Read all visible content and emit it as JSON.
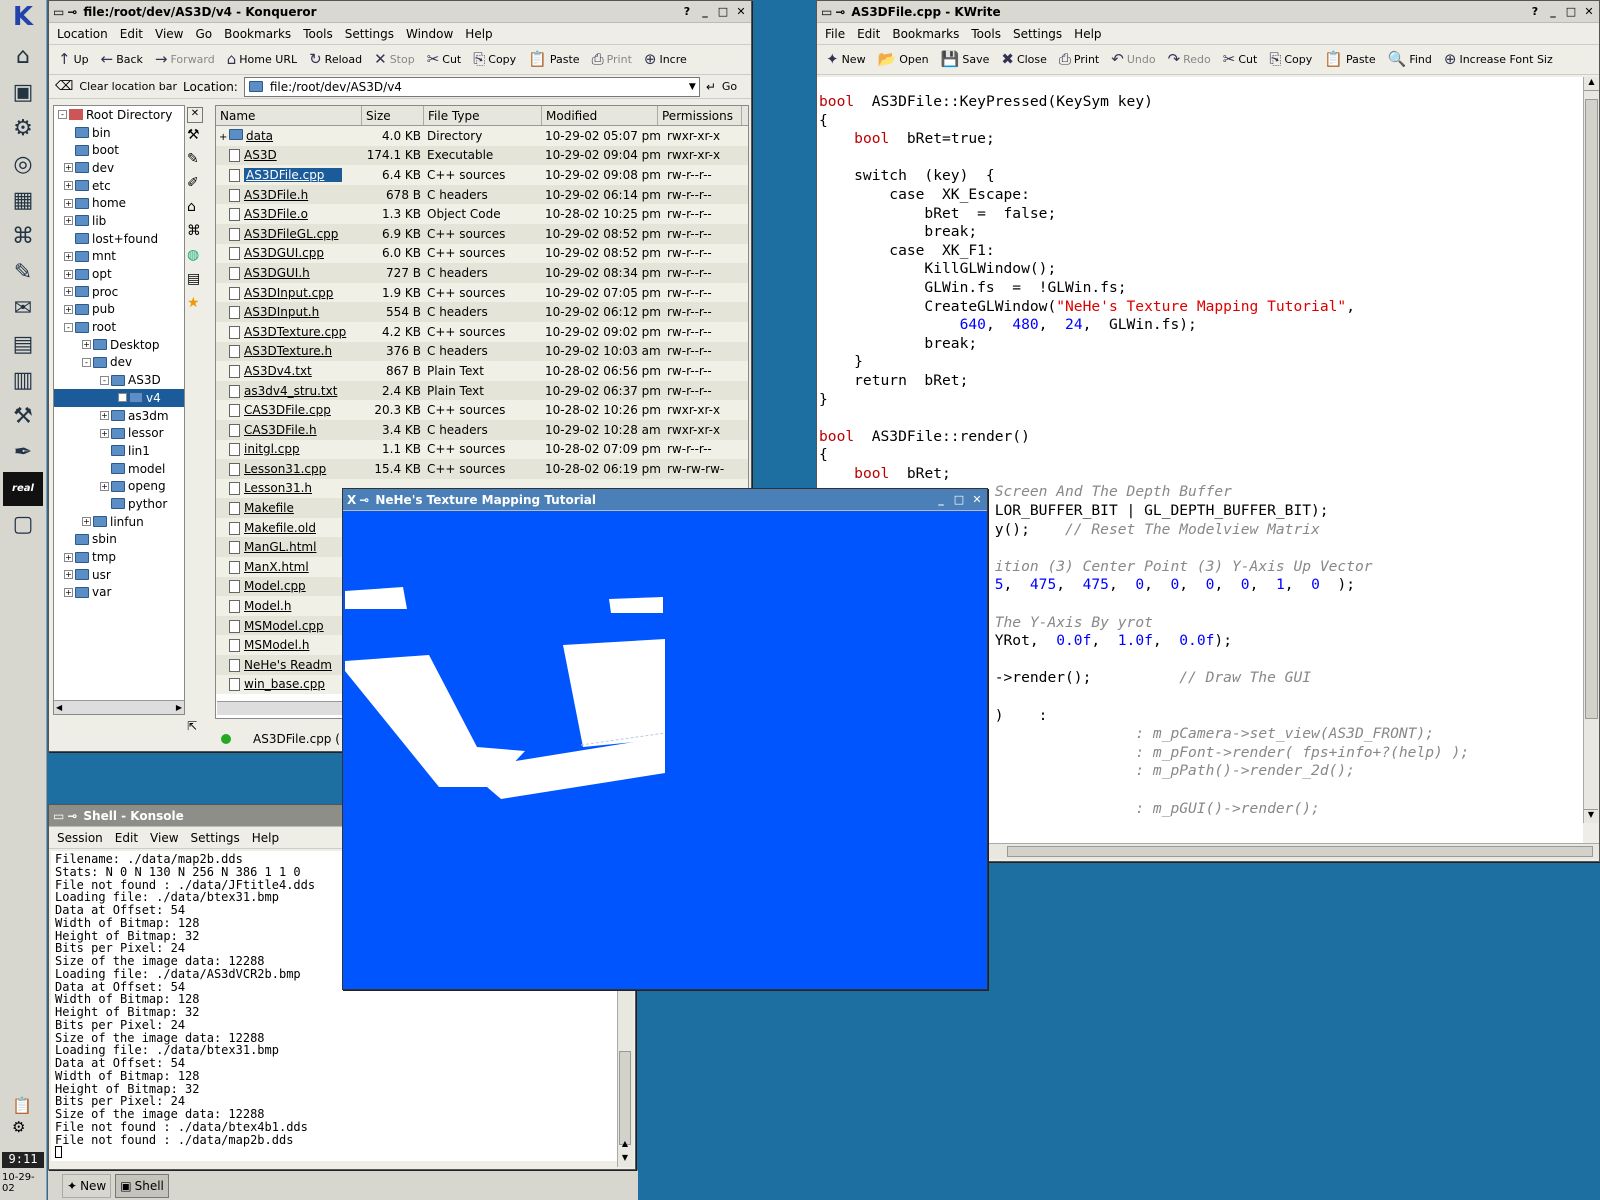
{
  "kicker": {
    "logo": "K",
    "icons": [
      "home-icon",
      "terminal-icon",
      "settings-icon",
      "lifebuoy-icon",
      "desktop-icon",
      "network-icon",
      "editor-icon",
      "mail-icon",
      "spreadsheet-icon",
      "chart-icon",
      "tool-icon",
      "pen-icon",
      "real-icon",
      "window-icon"
    ],
    "real_label": "real",
    "clock": "9:11",
    "date": "10-29-02",
    "taskbar": [
      {
        "label": "New"
      },
      {
        "label": "Shell"
      }
    ]
  },
  "konqueror": {
    "title": "file:/root/dev/AS3D/v4 - Konqueror",
    "menu": [
      "Location",
      "Edit",
      "View",
      "Go",
      "Bookmarks",
      "Tools",
      "Settings",
      "Window",
      "Help"
    ],
    "toolbar": [
      {
        "label": "Up",
        "icon": "↑"
      },
      {
        "label": "Back",
        "icon": "←"
      },
      {
        "label": "Forward",
        "icon": "→",
        "disabled": true
      },
      {
        "label": "Home URL",
        "icon": "⌂"
      },
      {
        "label": "Reload",
        "icon": "↻"
      },
      {
        "label": "Stop",
        "icon": "✕",
        "disabled": true
      },
      {
        "label": "Cut",
        "icon": "✂"
      },
      {
        "label": "Copy",
        "icon": "⎘"
      },
      {
        "label": "Paste",
        "icon": "📋"
      },
      {
        "label": "Print",
        "icon": "⎙",
        "disabled": true
      },
      {
        "label": "Incre",
        "icon": "⊕"
      }
    ],
    "clear_label": "Clear location bar",
    "location_label": "Location:",
    "location_value": "file:/root/dev/AS3D/v4",
    "go_label": "Go",
    "tree_root": "Root Directory",
    "tree": [
      {
        "label": "bin",
        "level": 1
      },
      {
        "label": "boot",
        "level": 1
      },
      {
        "label": "dev",
        "level": 1,
        "pm": "+"
      },
      {
        "label": "etc",
        "level": 1,
        "pm": "+"
      },
      {
        "label": "home",
        "level": 1,
        "pm": "+"
      },
      {
        "label": "lib",
        "level": 1,
        "pm": "+"
      },
      {
        "label": "lost+found",
        "level": 1
      },
      {
        "label": "mnt",
        "level": 1,
        "pm": "+"
      },
      {
        "label": "opt",
        "level": 1,
        "pm": "+"
      },
      {
        "label": "proc",
        "level": 1,
        "pm": "+"
      },
      {
        "label": "pub",
        "level": 1,
        "pm": "+"
      },
      {
        "label": "root",
        "level": 1,
        "pm": "-"
      },
      {
        "label": "Desktop",
        "level": 2,
        "pm": "+"
      },
      {
        "label": "dev",
        "level": 2,
        "pm": "-"
      },
      {
        "label": "AS3D",
        "level": 3,
        "pm": "-"
      },
      {
        "label": "v4",
        "level": 4,
        "pm": "+",
        "selected": true
      },
      {
        "label": "as3dm",
        "level": 3,
        "pm": "+"
      },
      {
        "label": "lessor",
        "level": 3,
        "pm": "+"
      },
      {
        "label": "lin1",
        "level": 3
      },
      {
        "label": "model",
        "level": 3
      },
      {
        "label": "openg",
        "level": 3,
        "pm": "+"
      },
      {
        "label": "pythor",
        "level": 3
      },
      {
        "label": "linfun",
        "level": 2,
        "pm": "+"
      },
      {
        "label": "sbin",
        "level": 1
      },
      {
        "label": "tmp",
        "level": 1,
        "pm": "+"
      },
      {
        "label": "usr",
        "level": 1,
        "pm": "+"
      },
      {
        "label": "var",
        "level": 1,
        "pm": "+"
      }
    ],
    "columns": [
      "Name",
      "Size",
      "File Type",
      "Modified",
      "Permissions"
    ],
    "files": [
      [
        "data",
        "4.0 KB",
        "Directory",
        "10-29-02 05:07 pm",
        "rwxr-xr-x"
      ],
      [
        "AS3D",
        "174.1 KB",
        "Executable",
        "10-29-02 09:04 pm",
        "rwxr-xr-x"
      ],
      [
        "AS3DFile.cpp",
        "6.4 KB",
        "C++ sources",
        "10-29-02 09:08 pm",
        "rw-r--r--"
      ],
      [
        "AS3DFile.h",
        "678 B",
        "C headers",
        "10-29-02 06:14 pm",
        "rw-r--r--"
      ],
      [
        "AS3DFile.o",
        "1.3 KB",
        "Object Code",
        "10-28-02 10:25 pm",
        "rw-r--r--"
      ],
      [
        "AS3DFileGL.cpp",
        "6.9 KB",
        "C++ sources",
        "10-29-02 08:52 pm",
        "rw-r--r--"
      ],
      [
        "AS3DGUI.cpp",
        "6.0 KB",
        "C++ sources",
        "10-29-02 08:52 pm",
        "rw-r--r--"
      ],
      [
        "AS3DGUI.h",
        "727 B",
        "C headers",
        "10-29-02 08:34 pm",
        "rw-r--r--"
      ],
      [
        "AS3DInput.cpp",
        "1.9 KB",
        "C++ sources",
        "10-29-02 07:05 pm",
        "rw-r--r--"
      ],
      [
        "AS3DInput.h",
        "554 B",
        "C headers",
        "10-29-02 06:12 pm",
        "rw-r--r--"
      ],
      [
        "AS3DTexture.cpp",
        "4.2 KB",
        "C++ sources",
        "10-29-02 09:02 pm",
        "rw-r--r--"
      ],
      [
        "AS3DTexture.h",
        "376 B",
        "C headers",
        "10-29-02 10:03 am",
        "rw-r--r--"
      ],
      [
        "AS3Dv4.txt",
        "867 B",
        "Plain Text",
        "10-28-02 06:56 pm",
        "rw-r--r--"
      ],
      [
        "as3dv4_stru.txt",
        "2.4 KB",
        "Plain Text",
        "10-29-02 06:37 pm",
        "rw-r--r--"
      ],
      [
        "CAS3DFile.cpp",
        "20.3 KB",
        "C++ sources",
        "10-28-02 10:26 pm",
        "rwxr-xr-x"
      ],
      [
        "CAS3DFile.h",
        "3.4 KB",
        "C headers",
        "10-29-02 10:28 am",
        "rwxr-xr-x"
      ],
      [
        "initgl.cpp",
        "1.1 KB",
        "C++ sources",
        "10-28-02 07:09 pm",
        "rw-r--r--"
      ],
      [
        "Lesson31.cpp",
        "15.4 KB",
        "C++ sources",
        "10-28-02 06:19 pm",
        "rw-rw-rw-"
      ],
      [
        "Lesson31.h",
        "",
        "",
        "",
        ""
      ],
      [
        "Makefile",
        "",
        "",
        "",
        ""
      ],
      [
        "Makefile.old",
        "",
        "",
        "",
        ""
      ],
      [
        "ManGL.html",
        "",
        "",
        "",
        ""
      ],
      [
        "ManX.html",
        "",
        "",
        "",
        ""
      ],
      [
        "Model.cpp",
        "",
        "",
        "",
        ""
      ],
      [
        "Model.h",
        "",
        "",
        "",
        ""
      ],
      [
        "MSModel.cpp",
        "",
        "",
        "",
        ""
      ],
      [
        "MSModel.h",
        "",
        "",
        "",
        ""
      ],
      [
        "NeHe's Readm",
        "",
        "",
        "",
        ""
      ],
      [
        "win_base.cpp",
        "",
        "",
        "",
        ""
      ]
    ],
    "selected_index": 2,
    "status": "AS3DFile.cpp ("
  },
  "kwrite": {
    "title": "AS3DFile.cpp - KWrite",
    "menu": [
      "File",
      "Edit",
      "Bookmarks",
      "Tools",
      "Settings",
      "Help"
    ],
    "toolbar": [
      {
        "label": "New",
        "icon": "✦"
      },
      {
        "label": "Open",
        "icon": "📂"
      },
      {
        "label": "Save",
        "icon": "💾"
      },
      {
        "label": "Close",
        "icon": "✖"
      },
      {
        "label": "Print",
        "icon": "⎙"
      },
      {
        "label": "Undo",
        "icon": "↶",
        "disabled": true
      },
      {
        "label": "Redo",
        "icon": "↷",
        "disabled": true
      },
      {
        "label": "Cut",
        "icon": "✂"
      },
      {
        "label": "Copy",
        "icon": "⎘"
      },
      {
        "label": "Paste",
        "icon": "📋"
      },
      {
        "label": "Find",
        "icon": "🔍"
      },
      {
        "label": "Increase Font Siz",
        "icon": "⊕"
      }
    ],
    "code": [
      [
        [
          "kw",
          "bool"
        ],
        [
          "",
          "  AS3DFile::KeyPressed(KeySym key)"
        ]
      ],
      [
        [
          "",
          "{"
        ]
      ],
      [
        [
          "",
          "    "
        ],
        [
          "kw",
          "bool"
        ],
        [
          "",
          "  bRet=true;"
        ]
      ],
      [
        [
          "",
          ""
        ]
      ],
      [
        [
          "",
          "    switch  (key)  {"
        ]
      ],
      [
        [
          "",
          "        case  XK_Escape:"
        ]
      ],
      [
        [
          "",
          "            bRet  =  false;"
        ]
      ],
      [
        [
          "",
          "            break;"
        ]
      ],
      [
        [
          "",
          "        case  XK_F1:"
        ]
      ],
      [
        [
          "",
          "            KillGLWindow();"
        ]
      ],
      [
        [
          "",
          "            GLWin.fs  =  !GLWin.fs;"
        ]
      ],
      [
        [
          "",
          "            CreateGLWindow("
        ],
        [
          "str",
          "\"NeHe's Texture Mapping Tutorial\""
        ],
        [
          "",
          ","
        ]
      ],
      [
        [
          "",
          "                "
        ],
        [
          "num",
          "640"
        ],
        [
          "",
          ",  "
        ],
        [
          "num",
          "480"
        ],
        [
          "",
          ",  "
        ],
        [
          "num",
          "24"
        ],
        [
          "",
          ",  GLWin.fs);"
        ]
      ],
      [
        [
          "",
          "            break;"
        ]
      ],
      [
        [
          "",
          "    }"
        ]
      ],
      [
        [
          "",
          "    return  bRet;"
        ]
      ],
      [
        [
          "",
          "}"
        ]
      ],
      [
        [
          "",
          ""
        ]
      ],
      [
        [
          "kw",
          "bool"
        ],
        [
          "",
          "  AS3DFile::render()"
        ]
      ],
      [
        [
          "",
          "{"
        ]
      ],
      [
        [
          "",
          "    "
        ],
        [
          "kw",
          "bool"
        ],
        [
          "",
          "  bRet;"
        ]
      ],
      [
        [
          "",
          "                    "
        ],
        [
          "cm",
          "Screen And The Depth Buffer"
        ]
      ],
      [
        [
          "",
          "                    LOR_BUFFER_BIT | GL_DEPTH_BUFFER_BIT);"
        ]
      ],
      [
        [
          "",
          "                    y();    "
        ],
        [
          "cm",
          "// Reset The Modelview Matrix"
        ]
      ],
      [
        [
          "",
          ""
        ]
      ],
      [
        [
          "",
          "                    "
        ],
        [
          "cm",
          "ition (3) Center Point (3) Y-Axis Up Vector"
        ]
      ],
      [
        [
          "",
          "                    "
        ],
        [
          "num",
          "5"
        ],
        [
          "",
          ",  "
        ],
        [
          "num",
          "475"
        ],
        [
          "",
          ",  "
        ],
        [
          "num",
          "475"
        ],
        [
          "",
          ",  "
        ],
        [
          "num",
          "0"
        ],
        [
          "",
          ",  "
        ],
        [
          "num",
          "0"
        ],
        [
          "",
          ",  "
        ],
        [
          "num",
          "0"
        ],
        [
          "",
          ",  "
        ],
        [
          "num",
          "0"
        ],
        [
          "",
          ",  "
        ],
        [
          "num",
          "1"
        ],
        [
          "",
          ",  "
        ],
        [
          "num",
          "0"
        ],
        [
          "",
          "  );"
        ]
      ],
      [
        [
          "",
          ""
        ]
      ],
      [
        [
          "",
          "                    "
        ],
        [
          "cm",
          "The Y-Axis By yrot"
        ]
      ],
      [
        [
          "",
          "                    YRot,  "
        ],
        [
          "num",
          "0.0f"
        ],
        [
          "",
          ",  "
        ],
        [
          "num",
          "1.0f"
        ],
        [
          "",
          ",  "
        ],
        [
          "num",
          "0.0f"
        ],
        [
          "",
          ");"
        ]
      ],
      [
        [
          "",
          ""
        ]
      ],
      [
        [
          "",
          "                    ->render();          "
        ],
        [
          "cm",
          "// Draw The GUI"
        ]
      ],
      [
        [
          "",
          ""
        ]
      ],
      [
        [
          "",
          "                    )    :"
        ]
      ],
      [
        [
          "",
          "                                    "
        ],
        [
          "cm",
          ": m_pCamera->set_view(AS3D_FRONT);"
        ]
      ],
      [
        [
          "",
          "                                    "
        ],
        [
          "cm",
          ": m_pFont->render( fps+info+?(help) );"
        ]
      ],
      [
        [
          "",
          "                                    "
        ],
        [
          "cm",
          ": m_pPath()->render_2d();"
        ]
      ],
      [
        [
          "",
          ""
        ]
      ],
      [
        [
          "",
          "                                    "
        ],
        [
          "cm",
          ": m_pGUI()->render();"
        ]
      ]
    ]
  },
  "konsole": {
    "title": "Shell - Konsole",
    "menu": [
      "Session",
      "Edit",
      "View",
      "Settings",
      "Help"
    ],
    "lines": [
      "Filename: ./data/map2b.dds",
      "Stats: N 0 N 130 N 256 N 386 1 1 0",
      "File not found : ./data/JFtitle4.dds",
      "Loading file: ./data/btex31.bmp",
      "Data at Offset: 54",
      "Width of Bitmap: 128",
      "Height of Bitmap: 32",
      "Bits per Pixel: 24",
      "Size of the image data: 12288",
      "Loading file: ./data/AS3dVCR2b.bmp",
      "Data at Offset: 54",
      "Width of Bitmap: 128",
      "Height of Bitmap: 32",
      "Bits per Pixel: 24",
      "Size of the image data: 12288",
      "Loading file: ./data/btex31.bmp",
      "Data at Offset: 54",
      "Width of Bitmap: 128",
      "Height of Bitmap: 32",
      "Bits per Pixel: 24",
      "Size of the image data: 12288",
      "File not found : ./data/btex4b1.dds",
      "File not found : ./data/map2b.dds"
    ]
  },
  "gl": {
    "title": "NeHe's Texture Mapping Tutorial",
    "bg": "#0055ff"
  }
}
